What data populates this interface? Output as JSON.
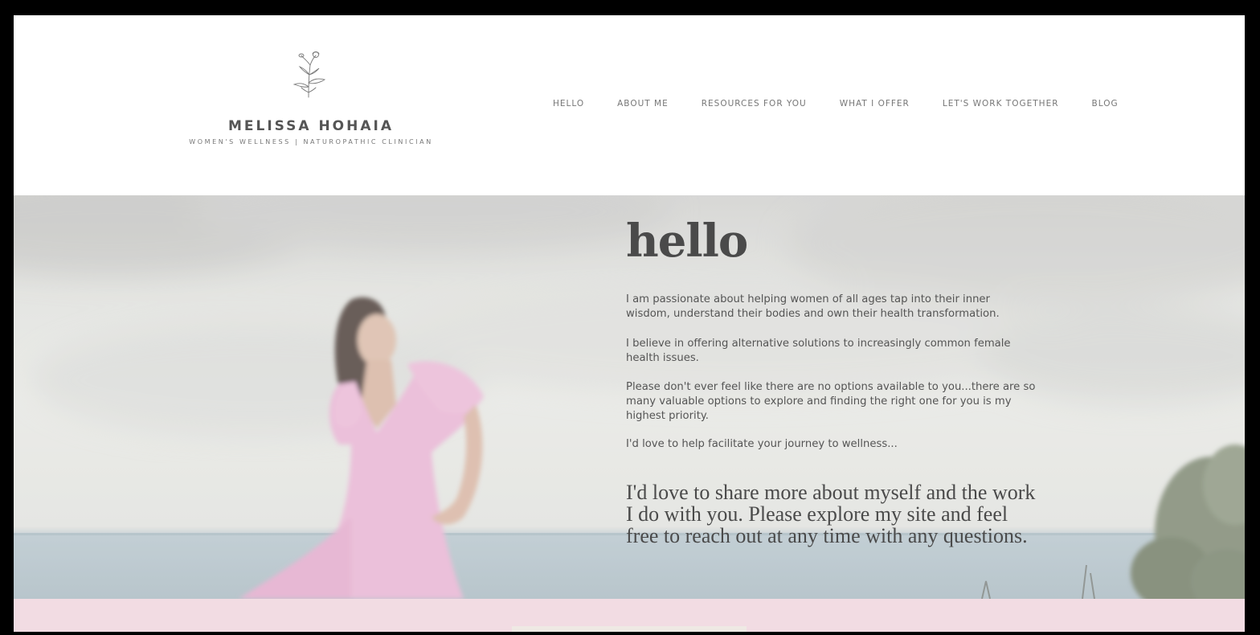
{
  "brand": {
    "name": "MELISSA HOHAIA",
    "tagline": "WOMEN'S WELLNESS | NATUROPATHIC CLINICIAN",
    "logo_icon": "flower-sprig-icon"
  },
  "nav": {
    "items": [
      {
        "label": "HELLO"
      },
      {
        "label": "ABOUT ME"
      },
      {
        "label": "RESOURCES FOR YOU"
      },
      {
        "label": "WHAT I OFFER"
      },
      {
        "label": "LET'S WORK TOGETHER"
      },
      {
        "label": "BLOG"
      }
    ]
  },
  "hero": {
    "heading": "hello",
    "paragraphs": [
      "I am passionate about helping women of all ages tap into their inner wisdom, understand their bodies and own their health transformation.",
      "I believe in offering alternative solutions to increasingly common female health issues.",
      "Please don't ever feel like there are no options available to you...there are so many valuable options to explore and finding the right one for you is my highest priority.",
      "I'd love to help facilitate your journey to wellness..."
    ],
    "quote": "I'd love to share more about myself and the work I do with you. Please explore my site and feel free to reach out at any time with any questions."
  },
  "colors": {
    "accent_pink": "#f2dce3",
    "text_dark": "#4a4a4a",
    "text_muted": "#777777",
    "dress_pink": "#e3a5cc"
  }
}
